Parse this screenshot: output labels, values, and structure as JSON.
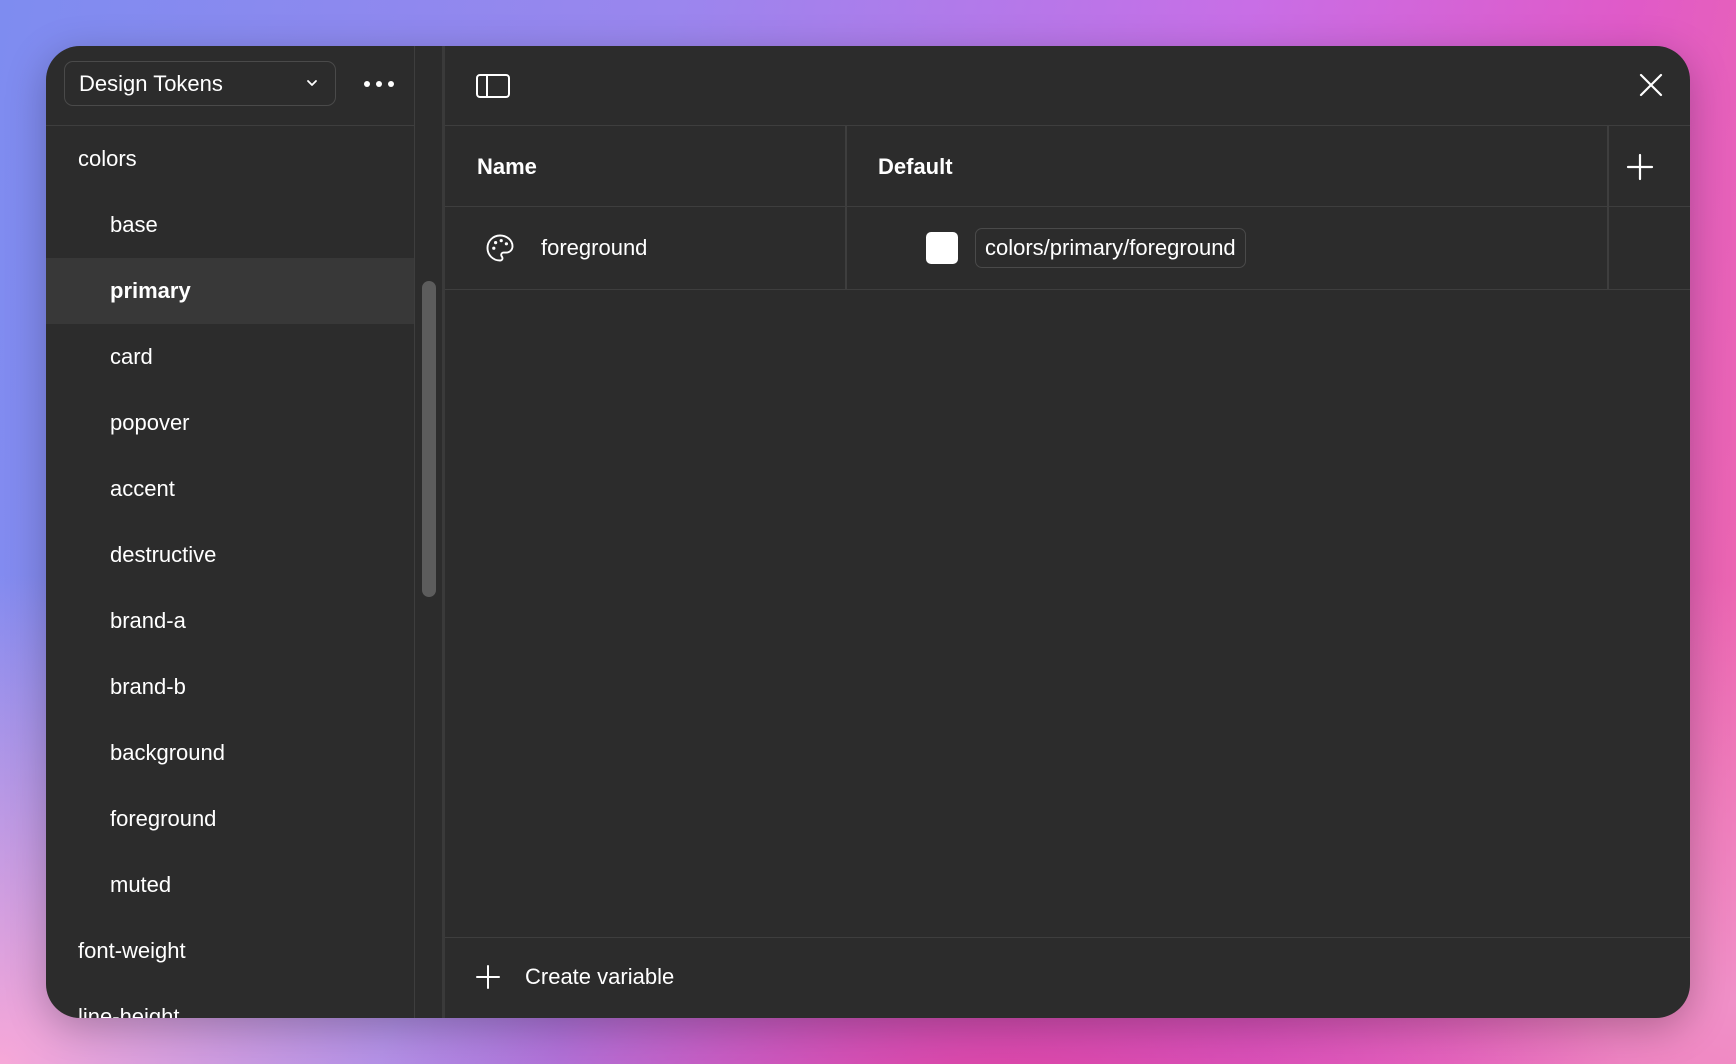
{
  "sidebar": {
    "collection_name": "Design Tokens",
    "groups": [
      {
        "label": "colors",
        "level": 0,
        "selected": false
      },
      {
        "label": "base",
        "level": 1,
        "selected": false
      },
      {
        "label": "primary",
        "level": 1,
        "selected": true
      },
      {
        "label": "card",
        "level": 1,
        "selected": false
      },
      {
        "label": "popover",
        "level": 1,
        "selected": false
      },
      {
        "label": "accent",
        "level": 1,
        "selected": false
      },
      {
        "label": "destructive",
        "level": 1,
        "selected": false
      },
      {
        "label": "brand-a",
        "level": 1,
        "selected": false
      },
      {
        "label": "brand-b",
        "level": 1,
        "selected": false
      },
      {
        "label": "background",
        "level": 1,
        "selected": false
      },
      {
        "label": "foreground",
        "level": 1,
        "selected": false
      },
      {
        "label": "muted",
        "level": 1,
        "selected": false
      },
      {
        "label": "font-weight",
        "level": 0,
        "selected": false
      },
      {
        "label": "line-height",
        "level": 0,
        "selected": false
      }
    ]
  },
  "table": {
    "columns": {
      "name": "Name",
      "default": "Default"
    },
    "rows": [
      {
        "icon": "palette-icon",
        "name": "foreground",
        "swatch_color": "#ffffff",
        "alias": "colors/primary/foreground"
      }
    ]
  },
  "footer": {
    "create_label": "Create variable"
  },
  "colors": {
    "window_bg": "#2c2c2c",
    "selected_row_bg": "#383838",
    "border": "#3e3e3e",
    "text": "#ffffff"
  }
}
